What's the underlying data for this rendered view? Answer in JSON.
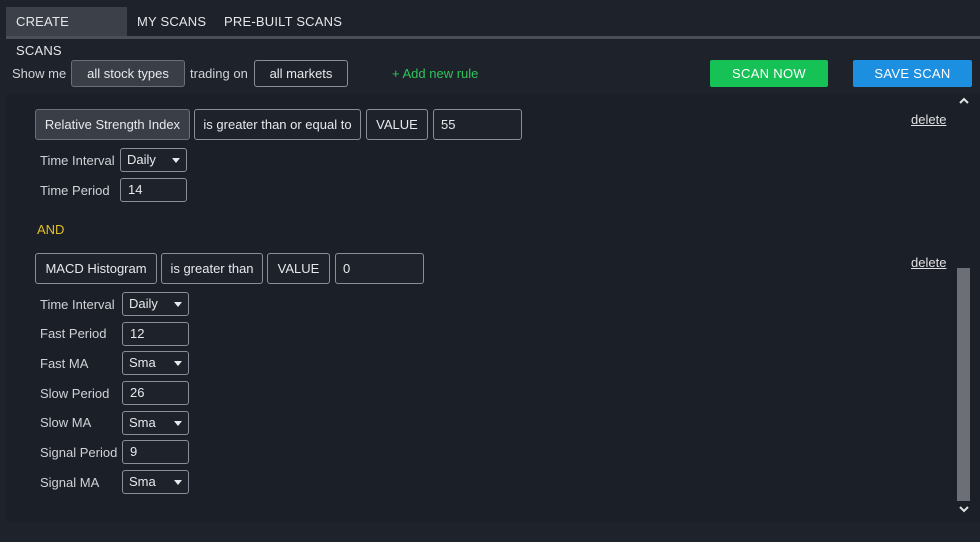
{
  "tabs": [
    {
      "label": "CREATE SCANS",
      "active": true
    },
    {
      "label": "MY SCANS",
      "active": false
    },
    {
      "label": "PRE-BUILT SCANS",
      "active": false
    }
  ],
  "toolbar": {
    "show_me_label": "Show me",
    "stock_types": "all stock types",
    "trading_on_label": "trading on",
    "markets": "all markets",
    "add_rule": "+ Add new rule",
    "scan_now": "SCAN NOW",
    "save_scan": "SAVE SCAN"
  },
  "rules": [
    {
      "indicator": "Relative Strength Index",
      "operator": "is greater than or equal to",
      "compare_type": "VALUE",
      "value": "55",
      "delete_label": "delete",
      "params": [
        {
          "label": "Time Interval",
          "value": "Daily",
          "kind": "select"
        },
        {
          "label": "Time Period",
          "value": "14",
          "kind": "input"
        }
      ]
    },
    {
      "indicator": "MACD Histogram",
      "operator": "is greater than",
      "compare_type": "VALUE",
      "value": "0",
      "delete_label": "delete",
      "params": [
        {
          "label": "Time Interval",
          "value": "Daily",
          "kind": "select"
        },
        {
          "label": "Fast Period",
          "value": "12",
          "kind": "input"
        },
        {
          "label": "Fast MA",
          "value": "Sma",
          "kind": "select"
        },
        {
          "label": "Slow Period",
          "value": "26",
          "kind": "input"
        },
        {
          "label": "Slow MA",
          "value": "Sma",
          "kind": "select"
        },
        {
          "label": "Signal Period",
          "value": "9",
          "kind": "input"
        },
        {
          "label": "Signal MA",
          "value": "Sma",
          "kind": "select"
        }
      ]
    }
  ],
  "connector": "AND",
  "colors": {
    "background": "#1e222b",
    "scan_now": "#16c255",
    "save_scan": "#1d8fe0",
    "add_rule": "#2ec45a",
    "connector": "#e5bf2b"
  }
}
